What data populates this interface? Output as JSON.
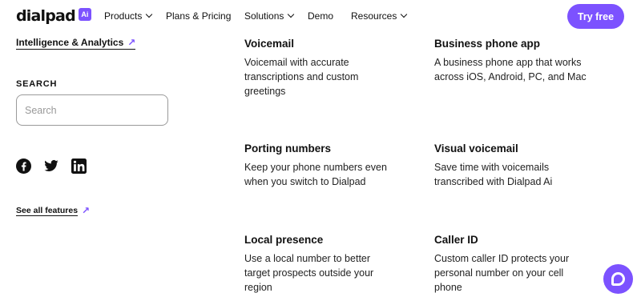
{
  "nav": {
    "logo_text": "dialpad",
    "logo_badge": "Ai",
    "items": [
      "Products",
      "Plans & Pricing",
      "Solutions",
      "Demo",
      "Resources"
    ],
    "cta": "Try free"
  },
  "sidebar": {
    "intel_link": "Intelligence & Analytics",
    "search_heading": "SEARCH",
    "search_placeholder": "Search",
    "see_all": "See all features",
    "social_icons": [
      "facebook-icon",
      "twitter-icon",
      "linkedin-icon"
    ]
  },
  "features": [
    {
      "title": "Voicemail",
      "desc": "Voicemail with accurate transcriptions and custom greetings"
    },
    {
      "title": "Business phone app",
      "desc": "A business phone app that works across iOS, Android, PC, and Mac"
    },
    {
      "title": "Porting numbers",
      "desc": "Keep your phone numbers even when you switch to Dialpad"
    },
    {
      "title": "Visual voicemail",
      "desc": "Save time with voicemails transcribed with Dialpad Ai"
    },
    {
      "title": "Local presence",
      "desc": "Use a local number to better target prospects outside your region"
    },
    {
      "title": "Caller ID",
      "desc": "Custom caller ID protects your personal number on your cell phone"
    }
  ],
  "colors": {
    "accent": "#7c52ff",
    "text": "#111111"
  }
}
